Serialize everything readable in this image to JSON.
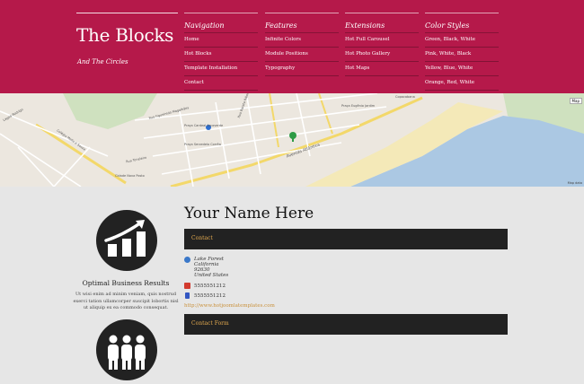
{
  "brand": {
    "title": "The Blocks",
    "subtitle": "And The Circles"
  },
  "menu": [
    {
      "heading": "Navigation",
      "items": [
        "Home",
        "Hot Blocks",
        "Template Installation",
        "Contact"
      ]
    },
    {
      "heading": "Features",
      "items": [
        "Infinite Colors",
        "Module Positions",
        "Typography"
      ]
    },
    {
      "heading": "Extensions",
      "items": [
        "Hot Full Carousel",
        "Hot Photo Gallery",
        "Hot Maps"
      ]
    },
    {
      "heading": "Color Styles",
      "items": [
        "Green, Black, White",
        "Pink, White, Black",
        "Yellow, Blue, White",
        "Orange, Red, White"
      ]
    }
  ],
  "map": {
    "labels": [
      "Praça Cardeal Arcoverde",
      "Avenida Atlântica",
      "Rua Toneleiro",
      "Cidade Nova Posto",
      "Lagoa Rodrigo",
      "Rua Barata Ribeiro",
      "Praça Serzedelo Corrêa",
      "Praça Eugênio Jardim",
      "Colégio Mello e Souza",
      "Rua Figueiredo Magalhães",
      "Copacabana"
    ],
    "button": "Map",
    "credit": "Map data"
  },
  "feature": {
    "title": "Optimal Business Results",
    "text": "Ut wisi enim ad minim veniam, quis nostrud exerci tation ullamcorper suscipit lobortis nisl ut aliquip ex ea commodo consequat."
  },
  "main": {
    "title": "Your Name Here",
    "contact_label": "Contact",
    "address": [
      "Lake Forest",
      "California",
      "92630",
      "United States"
    ],
    "phone": "5555551212",
    "mobile": "5555551212",
    "website": "http://www.hotjoomlatemplates.com",
    "contact_form_label": "Contact Form"
  },
  "colors": {
    "header": "#b5194a",
    "dark_bar": "#222222",
    "accent": "#e2a94f"
  }
}
